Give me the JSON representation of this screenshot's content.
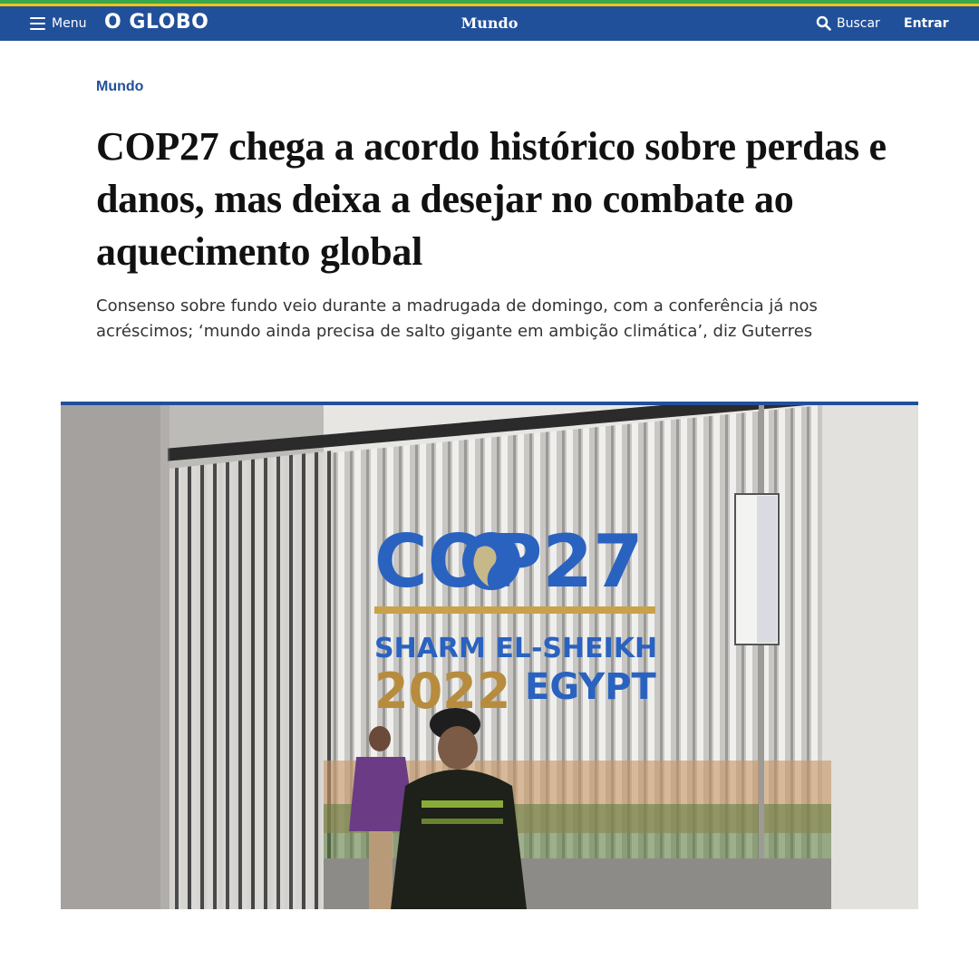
{
  "header": {
    "menu_label": "Menu",
    "logo": "O GLOBO",
    "section": "Mundo",
    "search_label": "Buscar",
    "login_label": "Entrar"
  },
  "article": {
    "kicker": "Mundo",
    "headline": "COP27 chega a acordo histórico sobre perdas e danos, mas deixa a desejar no combate ao aquecimento global",
    "subtitle": "Consenso sobre fundo veio durante a madrugada de domingo, com a conferência já nos acréscimos; ‘mundo ainda precisa de salto gigante em ambição climática’, diz Guterres"
  },
  "photo": {
    "sign_cop": "COP27",
    "sign_city": "SHARM EL-SHEIKH",
    "sign_year": "2022",
    "sign_country": "EGYPT"
  },
  "colors": {
    "brand_blue": "#21509a",
    "stripe_green": "#3aa84a",
    "stripe_yellow": "#f2c21a"
  }
}
